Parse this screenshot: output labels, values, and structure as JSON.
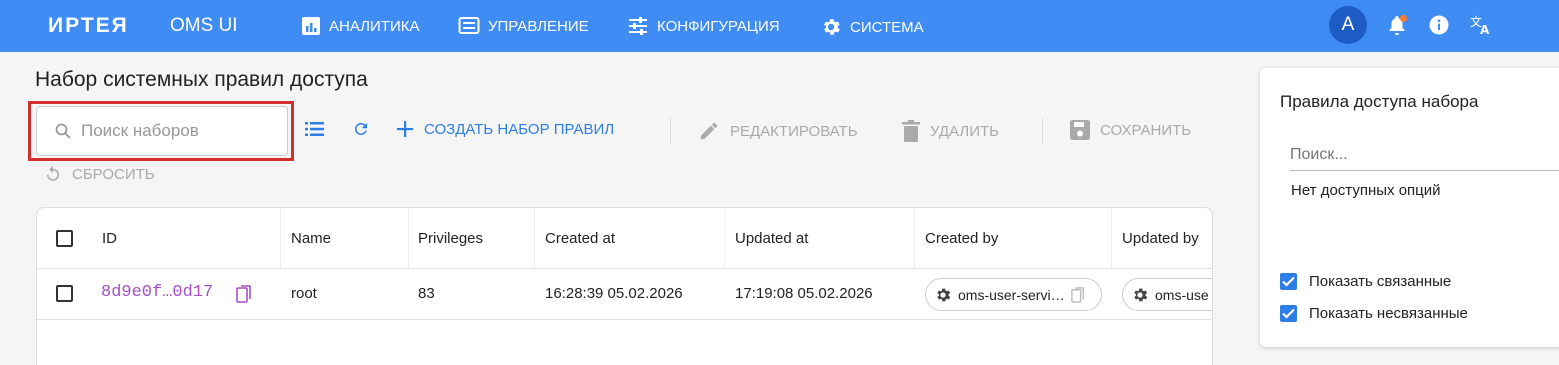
{
  "header": {
    "brand": "ИРТЕЯ",
    "app_name": "OMS UI",
    "nav": [
      {
        "label": "АНАЛИТИКА",
        "icon": "chart-icon"
      },
      {
        "label": "УПРАВЛЕНИЕ",
        "icon": "manage-icon"
      },
      {
        "label": "КОНФИГУРАЦИЯ",
        "icon": "sliders-icon"
      },
      {
        "label": "СИСТЕМА",
        "icon": "gear-icon"
      }
    ],
    "avatar_letter": "A",
    "bar_color": "#3f8cf5"
  },
  "page": {
    "title": "Набор системных правил доступа",
    "search_placeholder": "Поиск наборов"
  },
  "toolbar": {
    "create_label": "СОЗДАТЬ НАБОР ПРАВИЛ",
    "edit_label": "РЕДАКТИРОВАТЬ",
    "delete_label": "УДАЛИТЬ",
    "save_label": "СОХРАНИТЬ",
    "reset_label": "СБРОСИТЬ"
  },
  "table": {
    "columns": [
      "ID",
      "Name",
      "Privileges",
      "Created at",
      "Updated at",
      "Created by",
      "Updated by"
    ],
    "rows": [
      {
        "id": "8d9e0f…0d17",
        "name": "root",
        "privileges": "83",
        "created_at": "16:28:39 05.02.2026",
        "updated_at": "17:19:08 05.02.2026",
        "created_by": "oms-user-servi…",
        "updated_by": "oms-use"
      }
    ]
  },
  "panel": {
    "title": "Правила доступа набора",
    "search_placeholder": "Поиск...",
    "empty_text": "Нет доступных опций",
    "show_linked_label": "Показать связанные",
    "show_unlinked_label": "Показать несвязанные",
    "show_linked": true,
    "show_unlinked": true
  }
}
